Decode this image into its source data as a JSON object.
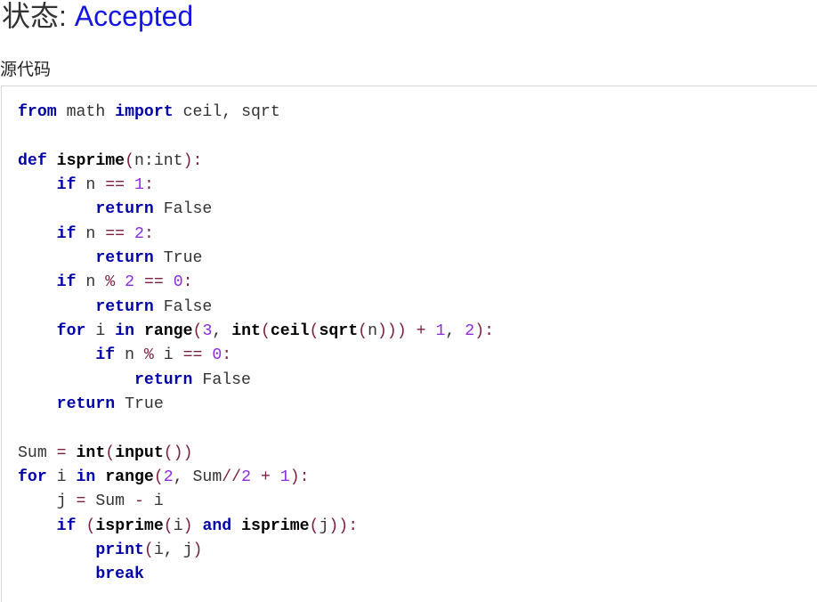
{
  "status": {
    "label": "状态: ",
    "value": "Accepted"
  },
  "source": {
    "title": "源代码"
  },
  "colors": {
    "status_value": "#1515e6",
    "keyword": "#0000aa",
    "number": "#8a2be2",
    "operator": "#7a1f3d"
  },
  "code_lines": [
    [
      {
        "t": "kw",
        "v": "from"
      },
      {
        "t": "txt",
        "v": " math "
      },
      {
        "t": "kw",
        "v": "import"
      },
      {
        "t": "txt",
        "v": " ceil, sqrt"
      }
    ],
    [],
    [
      {
        "t": "kw",
        "v": "def"
      },
      {
        "t": "txt",
        "v": " "
      },
      {
        "t": "fn",
        "v": "isprime"
      },
      {
        "t": "op",
        "v": "("
      },
      {
        "t": "txt",
        "v": "n:int"
      },
      {
        "t": "op",
        "v": "):"
      }
    ],
    [
      {
        "t": "txt",
        "v": "    "
      },
      {
        "t": "kw",
        "v": "if"
      },
      {
        "t": "txt",
        "v": " n "
      },
      {
        "t": "op",
        "v": "=="
      },
      {
        "t": "txt",
        "v": " "
      },
      {
        "t": "num",
        "v": "1"
      },
      {
        "t": "op",
        "v": ":"
      }
    ],
    [
      {
        "t": "txt",
        "v": "        "
      },
      {
        "t": "kw",
        "v": "return"
      },
      {
        "t": "txt",
        "v": " False"
      }
    ],
    [
      {
        "t": "txt",
        "v": "    "
      },
      {
        "t": "kw",
        "v": "if"
      },
      {
        "t": "txt",
        "v": " n "
      },
      {
        "t": "op",
        "v": "=="
      },
      {
        "t": "txt",
        "v": " "
      },
      {
        "t": "num",
        "v": "2"
      },
      {
        "t": "op",
        "v": ":"
      }
    ],
    [
      {
        "t": "txt",
        "v": "        "
      },
      {
        "t": "kw",
        "v": "return"
      },
      {
        "t": "txt",
        "v": " True"
      }
    ],
    [
      {
        "t": "txt",
        "v": "    "
      },
      {
        "t": "kw",
        "v": "if"
      },
      {
        "t": "txt",
        "v": " n "
      },
      {
        "t": "op",
        "v": "%"
      },
      {
        "t": "txt",
        "v": " "
      },
      {
        "t": "num",
        "v": "2"
      },
      {
        "t": "txt",
        "v": " "
      },
      {
        "t": "op",
        "v": "=="
      },
      {
        "t": "txt",
        "v": " "
      },
      {
        "t": "num",
        "v": "0"
      },
      {
        "t": "op",
        "v": ":"
      }
    ],
    [
      {
        "t": "txt",
        "v": "        "
      },
      {
        "t": "kw",
        "v": "return"
      },
      {
        "t": "txt",
        "v": " False"
      }
    ],
    [
      {
        "t": "txt",
        "v": "    "
      },
      {
        "t": "kw",
        "v": "for"
      },
      {
        "t": "txt",
        "v": " i "
      },
      {
        "t": "kw",
        "v": "in"
      },
      {
        "t": "txt",
        "v": " "
      },
      {
        "t": "bi",
        "v": "range"
      },
      {
        "t": "op",
        "v": "("
      },
      {
        "t": "num",
        "v": "3"
      },
      {
        "t": "txt",
        "v": ", "
      },
      {
        "t": "bi",
        "v": "int"
      },
      {
        "t": "op",
        "v": "("
      },
      {
        "t": "bi",
        "v": "ceil"
      },
      {
        "t": "op",
        "v": "("
      },
      {
        "t": "bi",
        "v": "sqrt"
      },
      {
        "t": "op",
        "v": "("
      },
      {
        "t": "txt",
        "v": "n"
      },
      {
        "t": "op",
        "v": ")))"
      },
      {
        "t": "txt",
        "v": " "
      },
      {
        "t": "op",
        "v": "+"
      },
      {
        "t": "txt",
        "v": " "
      },
      {
        "t": "num",
        "v": "1"
      },
      {
        "t": "txt",
        "v": ", "
      },
      {
        "t": "num",
        "v": "2"
      },
      {
        "t": "op",
        "v": "):"
      }
    ],
    [
      {
        "t": "txt",
        "v": "        "
      },
      {
        "t": "kw",
        "v": "if"
      },
      {
        "t": "txt",
        "v": " n "
      },
      {
        "t": "op",
        "v": "%"
      },
      {
        "t": "txt",
        "v": " i "
      },
      {
        "t": "op",
        "v": "=="
      },
      {
        "t": "txt",
        "v": " "
      },
      {
        "t": "num",
        "v": "0"
      },
      {
        "t": "op",
        "v": ":"
      }
    ],
    [
      {
        "t": "txt",
        "v": "            "
      },
      {
        "t": "kw",
        "v": "return"
      },
      {
        "t": "txt",
        "v": " False"
      }
    ],
    [
      {
        "t": "txt",
        "v": "    "
      },
      {
        "t": "kw",
        "v": "return"
      },
      {
        "t": "txt",
        "v": " True"
      }
    ],
    [],
    [
      {
        "t": "txt",
        "v": "Sum "
      },
      {
        "t": "op",
        "v": "="
      },
      {
        "t": "txt",
        "v": " "
      },
      {
        "t": "bi",
        "v": "int"
      },
      {
        "t": "op",
        "v": "("
      },
      {
        "t": "bi",
        "v": "input"
      },
      {
        "t": "op",
        "v": "())"
      }
    ],
    [
      {
        "t": "kw",
        "v": "for"
      },
      {
        "t": "txt",
        "v": " i "
      },
      {
        "t": "kw",
        "v": "in"
      },
      {
        "t": "txt",
        "v": " "
      },
      {
        "t": "bi",
        "v": "range"
      },
      {
        "t": "op",
        "v": "("
      },
      {
        "t": "num",
        "v": "2"
      },
      {
        "t": "txt",
        "v": ", Sum"
      },
      {
        "t": "op",
        "v": "//"
      },
      {
        "t": "num",
        "v": "2"
      },
      {
        "t": "txt",
        "v": " "
      },
      {
        "t": "op",
        "v": "+"
      },
      {
        "t": "txt",
        "v": " "
      },
      {
        "t": "num",
        "v": "1"
      },
      {
        "t": "op",
        "v": "):"
      }
    ],
    [
      {
        "t": "txt",
        "v": "    j "
      },
      {
        "t": "op",
        "v": "="
      },
      {
        "t": "txt",
        "v": " Sum "
      },
      {
        "t": "op",
        "v": "-"
      },
      {
        "t": "txt",
        "v": " i"
      }
    ],
    [
      {
        "t": "txt",
        "v": "    "
      },
      {
        "t": "kw",
        "v": "if"
      },
      {
        "t": "txt",
        "v": " "
      },
      {
        "t": "op",
        "v": "("
      },
      {
        "t": "fn",
        "v": "isprime"
      },
      {
        "t": "op",
        "v": "("
      },
      {
        "t": "txt",
        "v": "i"
      },
      {
        "t": "op",
        "v": ")"
      },
      {
        "t": "txt",
        "v": " "
      },
      {
        "t": "kw",
        "v": "and"
      },
      {
        "t": "txt",
        "v": " "
      },
      {
        "t": "fn",
        "v": "isprime"
      },
      {
        "t": "op",
        "v": "("
      },
      {
        "t": "txt",
        "v": "j"
      },
      {
        "t": "op",
        "v": ")):"
      }
    ],
    [
      {
        "t": "txt",
        "v": "        "
      },
      {
        "t": "kw",
        "v": "print"
      },
      {
        "t": "op",
        "v": "("
      },
      {
        "t": "txt",
        "v": "i, j"
      },
      {
        "t": "op",
        "v": ")"
      }
    ],
    [
      {
        "t": "txt",
        "v": "        "
      },
      {
        "t": "kw",
        "v": "break"
      }
    ]
  ]
}
